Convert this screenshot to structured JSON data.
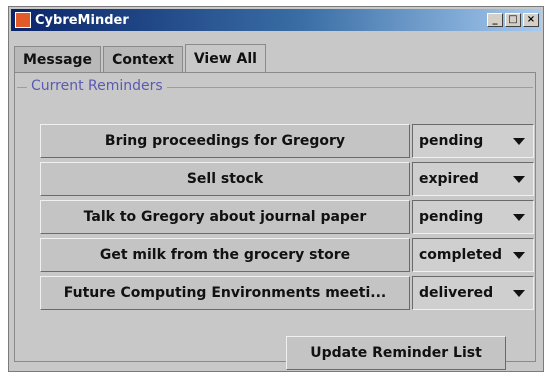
{
  "window": {
    "title": "CybreMinder",
    "minimize": "_",
    "maximize": "□",
    "close": "×"
  },
  "tabs": [
    {
      "label": "Message"
    },
    {
      "label": "Context"
    },
    {
      "label": "View All",
      "active": true
    }
  ],
  "group": {
    "label": "Current Reminders"
  },
  "reminders": [
    {
      "text": "Bring proceedings for Gregory",
      "status": "pending"
    },
    {
      "text": "Sell stock",
      "status": "expired"
    },
    {
      "text": "Talk to Gregory about journal paper",
      "status": "pending"
    },
    {
      "text": "Get milk from the grocery store",
      "status": "completed"
    },
    {
      "text": "Future Computing Environments meeti...",
      "status": "delivered"
    }
  ],
  "update_button": "Update Reminder List",
  "colors": {
    "titlebar_start": "#0a246a",
    "titlebar_end": "#a6caf0",
    "background": "#c8c8c8",
    "group_label": "#5a5ab0"
  }
}
